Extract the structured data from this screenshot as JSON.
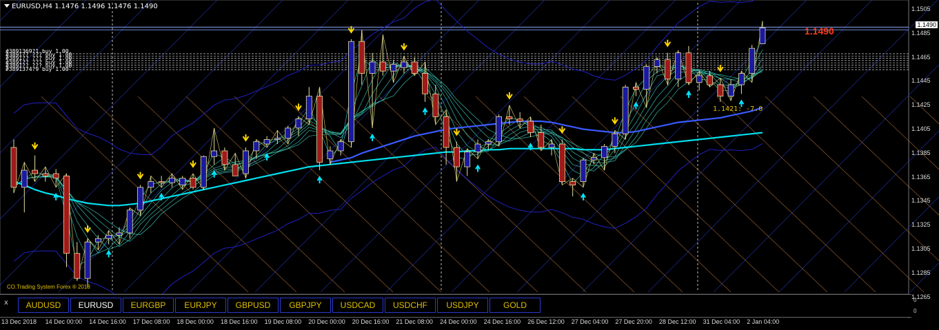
{
  "header": {
    "symbol_line": "EURUSD,H4  1.1476 1.1496 1.1476 1.1490"
  },
  "order_labels": [
    "#3891369?1 buy 1.00",
    "#3891?? ??? buy 1.00",
    "#3891?? ??? buy 1.00",
    "#3891?? ??? buy 1.00",
    "#3891?? ??? buy 1.00",
    "#3891374?9 buy 1.00"
  ],
  "current_price_display": "1.1490",
  "price_note": "1.1421: -7.0",
  "branding": "CO.Trading System Forex ® 2018",
  "price_axis": [
    "1.1505",
    "1.1485",
    "1.1465",
    "1.1445",
    "1.1425",
    "1.1405",
    "1.1385",
    "1.1365",
    "1.1345",
    "1.1325",
    "1.1305",
    "1.1285",
    "1.1265"
  ],
  "current_price_tag": "1.1490",
  "sub_axis": [
    "0",
    "0"
  ],
  "symbol_buttons": {
    "close_label": "x",
    "items": [
      "AUDUSD",
      "EURUSD",
      "EURGBP",
      "EURJPY",
      "GBPUSD",
      "GBPJPY",
      "USDCAD",
      "USDCHF",
      "USDJPY",
      "GOLD"
    ],
    "active": "EURUSD"
  },
  "time_axis": [
    "13 Dec 2018",
    "14 Dec 00:00",
    "14 Dec 16:00",
    "17 Dec 08:00",
    "18 Dec 00:00",
    "18 Dec 16:00",
    "19 Dec 08:00",
    "20 Dec 00:00",
    "20 Dec 16:00",
    "21 Dec 08:00",
    "24 Dec 00:00",
    "24 Dec 16:00",
    "26 Dec 12:00",
    "27 Dec 04:00",
    "27 Dec 20:00",
    "28 Dec 12:00",
    "31 Dec 04:00",
    "2 Jan 04:00"
  ],
  "colors": {
    "background": "#000000",
    "bull_candle": "#1a1aa0",
    "bear_candle": "#a01a1a",
    "arrow_buy": "#00e5ff",
    "arrow_sell": "#ffd700",
    "ma_slow": "#00e0f0",
    "ma_mid": "#3a5bff",
    "bands": "#2020c0"
  },
  "chart_data": {
    "type": "candlestick",
    "symbol": "EURUSD",
    "timeframe": "H4",
    "ylim": [
      1.1258,
      1.1512
    ],
    "candles": [
      [
        1.1385,
        1.1392,
        1.1345,
        1.135
      ],
      [
        1.135,
        1.1372,
        1.1328,
        1.1365
      ],
      [
        1.1365,
        1.1378,
        1.1355,
        1.1362
      ],
      [
        1.1362,
        1.1368,
        1.1355,
        1.136
      ],
      [
        1.1362,
        1.1366,
        1.135,
        1.1358
      ],
      [
        1.136,
        1.1362,
        1.128,
        1.1292
      ],
      [
        1.1292,
        1.1302,
        1.1268,
        1.127
      ],
      [
        1.127,
        1.1305,
        1.1262,
        1.1302
      ],
      [
        1.1302,
        1.1308,
        1.1295,
        1.1305
      ],
      [
        1.1305,
        1.1312,
        1.13,
        1.1308
      ],
      [
        1.1308,
        1.1315,
        1.13,
        1.131
      ],
      [
        1.131,
        1.1332,
        1.1305,
        1.133
      ],
      [
        1.133,
        1.1352,
        1.1325,
        1.135
      ],
      [
        1.135,
        1.136,
        1.1345,
        1.1355
      ],
      [
        1.1355,
        1.136,
        1.135,
        1.1354
      ],
      [
        1.1354,
        1.1362,
        1.135,
        1.1358
      ],
      [
        1.1352,
        1.136,
        1.1348,
        1.1358
      ],
      [
        1.1358,
        1.1362,
        1.1348,
        1.135
      ],
      [
        1.135,
        1.1378,
        1.1348,
        1.1377
      ],
      [
        1.1377,
        1.1402,
        1.137,
        1.1382
      ],
      [
        1.1382,
        1.1385,
        1.1365,
        1.137
      ],
      [
        1.137,
        1.138,
        1.136,
        1.136
      ],
      [
        1.1362,
        1.1385,
        1.1358,
        1.1382
      ],
      [
        1.1382,
        1.1392,
        1.1375,
        1.139
      ],
      [
        1.1388,
        1.1395,
        1.1385,
        1.1392
      ],
      [
        1.1392,
        1.14,
        1.1388,
        1.1393
      ],
      [
        1.1393,
        1.1404,
        1.1388,
        1.1402
      ],
      [
        1.1402,
        1.1412,
        1.1395,
        1.141
      ],
      [
        1.141,
        1.1438,
        1.1405,
        1.143
      ],
      [
        1.143,
        1.1438,
        1.1365,
        1.1372
      ],
      [
        1.1375,
        1.1386,
        1.137,
        1.1382
      ],
      [
        1.1382,
        1.1392,
        1.1378,
        1.139
      ],
      [
        1.139,
        1.148,
        1.1385,
        1.1478
      ],
      [
        1.1478,
        1.1488,
        1.144,
        1.145
      ],
      [
        1.145,
        1.1468,
        1.1402,
        1.146
      ],
      [
        1.146,
        1.1484,
        1.1448,
        1.1452
      ],
      [
        1.1452,
        1.1462,
        1.1442,
        1.1458
      ],
      [
        1.1455,
        1.1465,
        1.145,
        1.146
      ],
      [
        1.146,
        1.1464,
        1.1448,
        1.145
      ],
      [
        1.145,
        1.146,
        1.1425,
        1.1432
      ],
      [
        1.1432,
        1.144,
        1.1405,
        1.1412
      ],
      [
        1.1412,
        1.1418,
        1.137,
        1.1385
      ],
      [
        1.1385,
        1.139,
        1.1355,
        1.1368
      ],
      [
        1.1368,
        1.1384,
        1.136,
        1.1381
      ],
      [
        1.1381,
        1.1392,
        1.1375,
        1.1388
      ],
      [
        1.1388,
        1.1392,
        1.1383,
        1.139
      ],
      [
        1.139,
        1.1414,
        1.1386,
        1.1412
      ],
      [
        1.1412,
        1.1422,
        1.1405,
        1.141
      ],
      [
        1.141,
        1.1416,
        1.1402,
        1.1408
      ],
      [
        1.1408,
        1.1412,
        1.1394,
        1.1398
      ],
      [
        1.1398,
        1.1405,
        1.1382,
        1.1385
      ],
      [
        1.1385,
        1.1392,
        1.1378,
        1.1388
      ],
      [
        1.1388,
        1.1392,
        1.1352,
        1.1355
      ],
      [
        1.1355,
        1.1358,
        1.1342,
        1.1352
      ],
      [
        1.1355,
        1.1376,
        1.135,
        1.1374
      ],
      [
        1.1374,
        1.138,
        1.137,
        1.1376
      ],
      [
        1.1376,
        1.1388,
        1.1365,
        1.1386
      ],
      [
        1.1386,
        1.14,
        1.138,
        1.1397
      ],
      [
        1.1397,
        1.144,
        1.1392,
        1.1438
      ],
      [
        1.1438,
        1.1442,
        1.143,
        1.1436
      ],
      [
        1.1436,
        1.1458,
        1.142,
        1.1456
      ],
      [
        1.1456,
        1.1464,
        1.145,
        1.1462
      ],
      [
        1.1462,
        1.1468,
        1.144,
        1.1445
      ],
      [
        1.1445,
        1.147,
        1.1438,
        1.1468
      ],
      [
        1.1468,
        1.1474,
        1.144,
        1.1442
      ],
      [
        1.1442,
        1.1452,
        1.1435,
        1.1448
      ],
      [
        1.1448,
        1.1452,
        1.1438,
        1.144
      ],
      [
        1.144,
        1.1446,
        1.1425,
        1.143
      ],
      [
        1.143,
        1.1445,
        1.1426,
        1.144
      ],
      [
        1.144,
        1.1452,
        1.1432,
        1.145
      ],
      [
        1.145,
        1.1475,
        1.1442,
        1.1472
      ],
      [
        1.1476,
        1.1496,
        1.1476,
        1.149
      ]
    ],
    "ma_slow": [
      1.1355,
      1.1352,
      1.1348,
      1.1345,
      1.1343,
      1.134,
      1.1338,
      1.1336,
      1.1335,
      1.1334,
      1.1334,
      1.1335,
      1.1336,
      1.1338,
      1.134,
      1.1342,
      1.1344,
      1.1346,
      1.1348,
      1.135,
      1.1352,
      1.1354,
      1.1356,
      1.1358,
      1.136,
      1.1362,
      1.1364,
      1.1366,
      1.1368,
      1.1369,
      1.137,
      1.1371,
      1.1372,
      1.1373,
      1.1374,
      1.1375,
      1.1376,
      1.1377,
      1.1378,
      1.1379,
      1.138,
      1.1381,
      1.1381,
      1.1382,
      1.1382,
      1.1383,
      1.1383,
      1.1384,
      1.1384,
      1.1384,
      1.1384,
      1.1384,
      1.1384,
      1.1384,
      1.1383,
      1.1383,
      1.1383,
      1.1384,
      1.1385,
      1.1386,
      1.1387,
      1.1388,
      1.1389,
      1.139,
      1.1391,
      1.1392,
      1.1393,
      1.1394,
      1.1395,
      1.1396,
      1.1397,
      1.1398
    ],
    "ma_mid": [
      null,
      null,
      null,
      null,
      null,
      null,
      null,
      null,
      null,
      null,
      null,
      null,
      null,
      null,
      null,
      null,
      null,
      null,
      null,
      null,
      null,
      null,
      null,
      null,
      null,
      null,
      null,
      null,
      null,
      null,
      1.1372,
      1.1374,
      1.1376,
      1.138,
      1.1383,
      1.1386,
      1.1389,
      1.1392,
      1.1395,
      1.1397,
      1.1399,
      1.1401,
      1.1402,
      1.1403,
      1.1404,
      1.1405,
      1.1406,
      1.1407,
      1.1408,
      1.1408,
      1.1408,
      1.1407,
      1.1405,
      1.1403,
      1.1401,
      1.14,
      1.1399,
      1.1398,
      1.1398,
      1.1399,
      1.1401,
      1.1403,
      1.1405,
      1.1407,
      1.1408,
      1.1409,
      1.141,
      1.1411,
      1.1413,
      1.1415,
      1.1417,
      1.142
    ]
  }
}
